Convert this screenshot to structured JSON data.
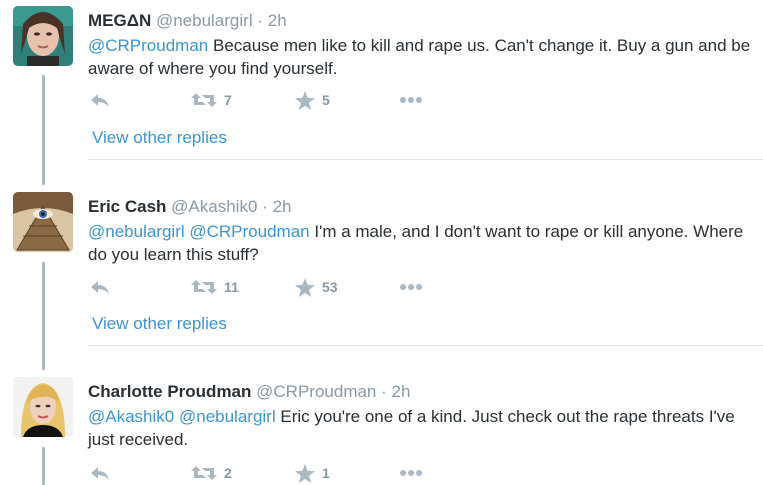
{
  "tweets": [
    {
      "name": "MEGΔN",
      "handle": "@nebulargirl",
      "dot": "·",
      "time": "2h",
      "mentions": [
        "@CRProudman"
      ],
      "text": "Because men like to kill and rape us. Can't change it. Buy a gun and be aware of where you find yourself.",
      "retweets": "7",
      "favorites": "5",
      "view_replies": "View other replies"
    },
    {
      "name": "Eric Cash",
      "handle": "@Akashik0",
      "dot": "·",
      "time": "2h",
      "mentions": [
        "@nebulargirl",
        "@CRProudman"
      ],
      "text": "I'm a male, and I don't want to rape or kill anyone. Where do you learn this stuff?",
      "retweets": "11",
      "favorites": "53",
      "view_replies": "View other replies"
    },
    {
      "name": "Charlotte Proudman",
      "handle": "@CRProudman",
      "dot": "·",
      "time": "2h",
      "mentions": [
        "@Akashik0",
        "@nebulargirl"
      ],
      "text": "Eric you're one of a kind. Just check out the rape threats I've just received.",
      "retweets": "2",
      "favorites": "1"
    }
  ],
  "icons": {
    "reply": "reply-icon",
    "retweet": "retweet-icon",
    "favorite": "star-icon",
    "more": "more-icon"
  },
  "colors": {
    "link": "#3b94d9",
    "muted": "#8899a6",
    "icon": "#aab8c2",
    "thread_line": "#aab8c2"
  }
}
